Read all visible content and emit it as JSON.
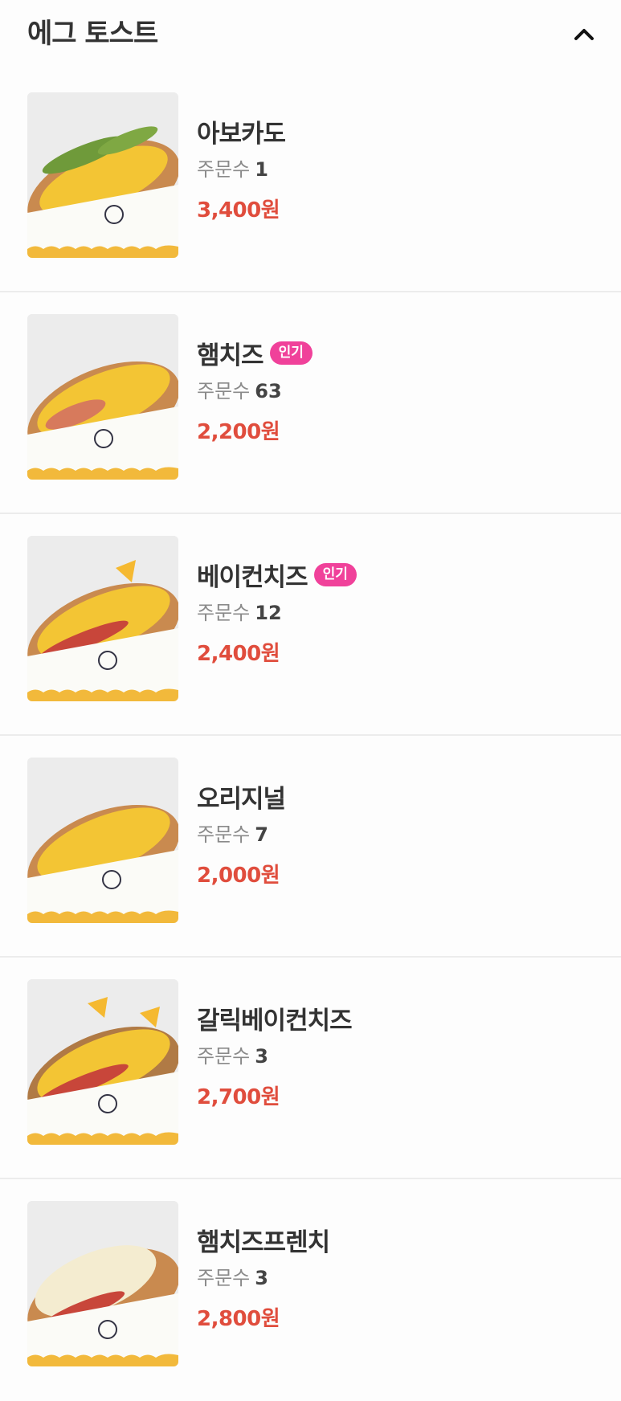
{
  "section": {
    "title": "에그 토스트",
    "collapse_icon": "chevron-up-icon"
  },
  "colors": {
    "price": "#e04d3d",
    "badge": "#f0419a",
    "divider": "#ececec"
  },
  "items": [
    {
      "name": "아보카도",
      "badge": "",
      "orders_label": "주문수",
      "orders": "1",
      "price": "3,400원",
      "image": "avocado-egg-toast-photo"
    },
    {
      "name": "햄치즈",
      "badge": "인기",
      "orders_label": "주문수",
      "orders": "63",
      "price": "2,200원",
      "image": "ham-cheese-egg-toast-photo"
    },
    {
      "name": "베이컨치즈",
      "badge": "인기",
      "orders_label": "주문수",
      "orders": "12",
      "price": "2,400원",
      "image": "bacon-cheese-egg-toast-photo"
    },
    {
      "name": "오리지널",
      "badge": "",
      "orders_label": "주문수",
      "orders": "7",
      "price": "2,000원",
      "image": "original-egg-toast-photo"
    },
    {
      "name": "갈릭베이컨치즈",
      "badge": "",
      "orders_label": "주문수",
      "orders": "3",
      "price": "2,700원",
      "image": "garlic-bacon-cheese-egg-toast-photo"
    },
    {
      "name": "햄치즈프렌치",
      "badge": "",
      "orders_label": "주문수",
      "orders": "3",
      "price": "2,800원",
      "image": "ham-cheese-french-egg-toast-photo"
    }
  ]
}
